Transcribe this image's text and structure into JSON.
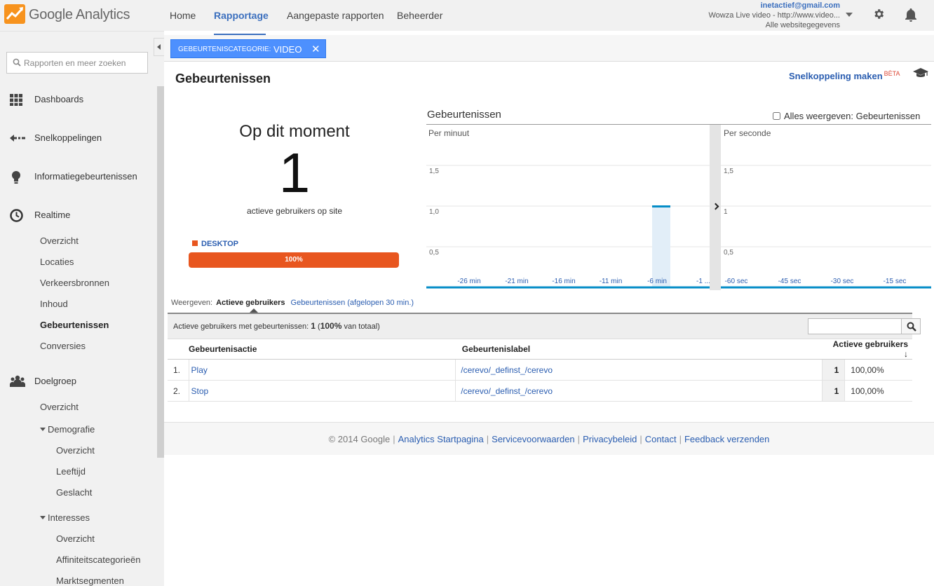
{
  "app": {
    "logo_text": "Google Analytics"
  },
  "topnav": {
    "items": [
      {
        "label": "Home"
      },
      {
        "label": "Rapportage"
      },
      {
        "label": "Aangepaste rapporten"
      },
      {
        "label": "Beheerder"
      }
    ],
    "active": "Rapportage"
  },
  "account": {
    "email": "inetactief@gmail.com",
    "property": "Wowza Live video - http://www.video...",
    "view": "Alle websitegegevens"
  },
  "sidebar": {
    "search_placeholder": "Rapporten en meer zoeken",
    "sections": [
      {
        "label": "Dashboards",
        "icon": "grid-icon"
      },
      {
        "label": "Snelkoppelingen",
        "icon": "shortcut-arrow-icon"
      },
      {
        "label": "Informatiegebeurtenissen",
        "icon": "lightbulb-icon"
      },
      {
        "label": "Realtime",
        "icon": "clock-icon"
      },
      {
        "label": "Doelgroep",
        "icon": "people-icon"
      }
    ],
    "realtime_items": [
      "Overzicht",
      "Locaties",
      "Verkeersbronnen",
      "Inhoud",
      "Gebeurtenissen",
      "Conversies"
    ],
    "realtime_active": "Gebeurtenissen",
    "audience_items": {
      "overview": "Overzicht",
      "demographics": "Demografie",
      "demographics_items": [
        "Overzicht",
        "Leeftijd",
        "Geslacht"
      ],
      "interests": "Interesses",
      "interests_items": [
        "Overzicht",
        "Affiniteitscategorieën",
        "Marktsegmenten"
      ]
    }
  },
  "filter": {
    "key": "GEBEURTENISCATEGORIE:",
    "value": "VIDEO",
    "remove": "✕"
  },
  "page": {
    "title": "Gebeurtenissen",
    "shortcut_label": "Snelkoppeling maken",
    "beta": "BÈTA"
  },
  "realtime": {
    "now_label": "Op dit moment",
    "count": "1",
    "caption": "actieve gebruikers op site",
    "device": {
      "label": "DESKTOP",
      "percent_label": "100%",
      "fraction": 1.0,
      "color": "#e8561f"
    }
  },
  "charts": {
    "title": "Gebeurtenissen",
    "show_all_label": "Alles weergeven: Gebeurtenissen",
    "show_all_checked": false
  },
  "chart_data": [
    {
      "type": "bar",
      "subtitle": "Per minuut",
      "x_tick_labels": [
        "-26 min",
        "-21 min",
        "-16 min",
        "-11 min",
        "-6 min",
        "-1 ..."
      ],
      "y_tick_labels": [
        "0,5",
        "1,0",
        "1,5"
      ],
      "ylim": [
        0,
        1.75
      ],
      "bars": [
        {
          "minutes_ago": 6,
          "value": 1
        }
      ],
      "grid": true,
      "color": "#058dc7"
    },
    {
      "type": "bar",
      "subtitle": "Per seconde",
      "x_tick_labels": [
        "-60 sec",
        "-45 sec",
        "-30 sec",
        "-15 sec"
      ],
      "y_tick_labels": [
        "0,5",
        "1",
        "1,5"
      ],
      "ylim": [
        0,
        1.75
      ],
      "bars": [],
      "grid": true,
      "color": "#058dc7"
    }
  ],
  "view_tabs": {
    "label": "Weergeven:",
    "active": "Actieve gebruikers",
    "other": "Gebeurtenissen (afgelopen 30 min.)"
  },
  "table": {
    "summary_prefix": "Actieve gebruikers met gebeurtenissen:",
    "summary_count": "1",
    "summary_pct": "100%",
    "summary_suffix": "van totaal)",
    "columns": [
      "Gebeurtenisactie",
      "Gebeurtenislabel",
      "Actieve gebruikers"
    ],
    "sort_icon": "↓",
    "rows": [
      {
        "num": "1.",
        "action": "Play",
        "label": "/cerevo/_definst_/cerevo",
        "value": "1",
        "pct": "100,00%"
      },
      {
        "num": "2.",
        "action": "Stop",
        "label": "/cerevo/_definst_/cerevo",
        "value": "1",
        "pct": "100,00%"
      }
    ]
  },
  "footer": {
    "copyright": "© 2014 Google",
    "links": [
      "Analytics Startpagina",
      "Servicevoorwaarden",
      "Privacybeleid",
      "Contact",
      "Feedback verzenden"
    ]
  }
}
